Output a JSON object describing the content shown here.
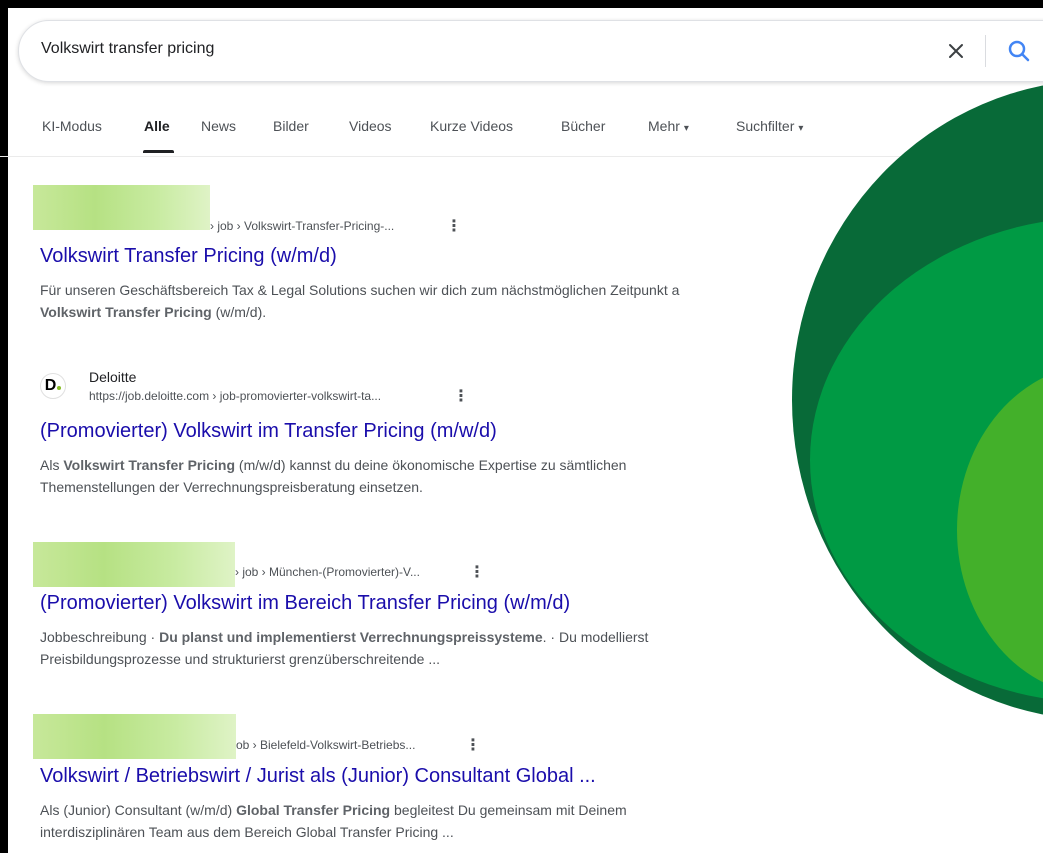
{
  "search": {
    "query": "Volkswirt transfer pricing"
  },
  "tabs": [
    {
      "label": "KI-Modus"
    },
    {
      "label": "Alle"
    },
    {
      "label": "News"
    },
    {
      "label": "Bilder"
    },
    {
      "label": "Videos"
    },
    {
      "label": "Kurze Videos"
    },
    {
      "label": "Bücher"
    },
    {
      "label": "Mehr"
    },
    {
      "label": "Suchfilter"
    }
  ],
  "results": [
    {
      "crumb": "› job › Volkswirt-Transfer-Pricing-...",
      "title": "Volkswirt Transfer Pricing (w/m/d)",
      "line1": "Für unseren Geschäftsbereich Tax & Legal Solutions suchen wir dich zum nächstmöglichen Zeitpunkt a",
      "line2_bold": "Volkswirt Transfer Pricing",
      "line2_rest": " (w/m/d)."
    },
    {
      "favicon_letter": "D",
      "site_name": "Deloitte",
      "crumb": "https://job.deloitte.com › job-promovierter-volkswirt-ta...",
      "title": "(Promovierter) Volkswirt im Transfer Pricing (m/w/d)",
      "line1_pre": "Als ",
      "line1_bold": "Volkswirt Transfer Pricing",
      "line1_rest": " (m/w/d) kannst du deine ökonomische Expertise zu sämtlichen",
      "line2": "Themenstellungen der Verrechnungspreisberatung einsetzen."
    },
    {
      "crumb": "› job › München-(Promovierter)-V...",
      "title": "(Promovierter) Volkswirt im Bereich Transfer Pricing (w/m/d)",
      "line1_pre": "Jobbeschreibung · ",
      "line1_bold": "Du planst und implementierst Verrechnungspreissysteme",
      "line1_rest": ". · Du modellierst",
      "line2": "Preisbildungsprozesse und strukturierst grenzüberschreitende ..."
    },
    {
      "crumb": "ob › Bielefeld-Volkswirt-Betriebs...",
      "title": "Volkswirt / Betriebswirt / Jurist als (Junior) Consultant Global ...",
      "line1_pre": "Als (Junior) Consultant (w/m/d) ",
      "line1_bold": "Global Transfer Pricing",
      "line1_rest": " begleitest Du gemeinsam mit Deinem",
      "line2": "interdisziplinären Team aus dem Bereich Global Transfer Pricing ..."
    }
  ],
  "colors": {
    "link": "#1a0dab",
    "logo_dark": "#086a38",
    "logo_mid": "#009a44",
    "logo_light": "#43b02a",
    "blur": "#b6e183"
  }
}
